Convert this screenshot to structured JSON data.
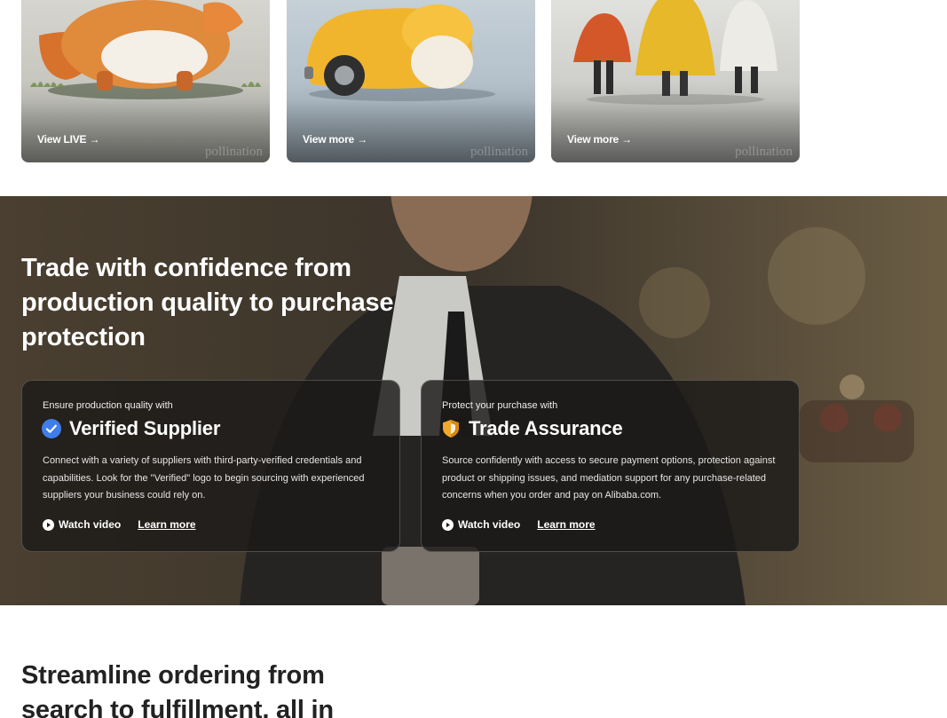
{
  "cards": [
    {
      "cta": "View LIVE →",
      "watermark": "pollination",
      "subject": "fox-creature-illustration"
    },
    {
      "cta": "View more →",
      "watermark": "pollination",
      "subject": "duck-car-illustration"
    },
    {
      "cta": "View more →",
      "watermark": "pollination",
      "subject": "three-kids-raincoats-illustration"
    }
  ],
  "hero": {
    "title": "Trade with confidence from production quality to purchase protection",
    "panels": [
      {
        "eyebrow": "Ensure production quality with",
        "name": "Verified Supplier",
        "icon": "verified-check-icon",
        "icon_color": "#3f7de8",
        "description": "Connect with a variety of suppliers with third-party-verified credentials and capabilities. Look for the \"Verified\" logo to begin sourcing with experienced suppliers your business could rely on.",
        "watch_label": "Watch video",
        "learn_label": "Learn more"
      },
      {
        "eyebrow": "Protect your purchase with",
        "name": "Trade Assurance",
        "icon": "shield-icon",
        "icon_color": "#f0a92a",
        "description": "Source confidently with access to secure payment options, protection against product or shipping issues, and mediation support for any purchase-related concerns when you order and pay on Alibaba.com.",
        "watch_label": "Watch video",
        "learn_label": "Learn more"
      }
    ]
  },
  "bottom": {
    "title": "Streamline ordering from search to fulfillment, all in"
  }
}
